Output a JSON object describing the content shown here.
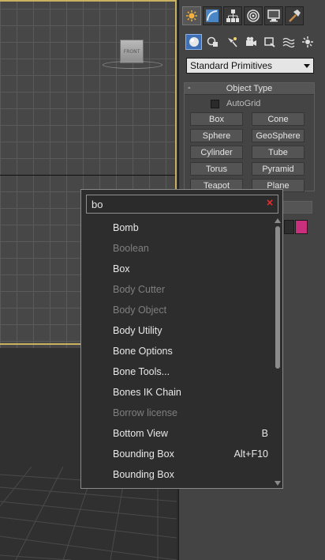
{
  "viewport": {
    "viewcube_label": "FRONT"
  },
  "command_panel": {
    "tabs": [
      {
        "icon": "create-icon",
        "active": true
      },
      {
        "icon": "modify-icon",
        "active": false
      },
      {
        "icon": "hierarchy-icon",
        "active": false
      },
      {
        "icon": "motion-icon",
        "active": false
      },
      {
        "icon": "display-icon",
        "active": false
      },
      {
        "icon": "utilities-icon",
        "active": false
      }
    ],
    "subtabs": [
      {
        "icon": "geometry-icon",
        "active": true
      },
      {
        "icon": "shapes-icon",
        "active": false
      },
      {
        "icon": "lights-icon",
        "active": false
      },
      {
        "icon": "cameras-icon",
        "active": false
      },
      {
        "icon": "helpers-icon",
        "active": false
      },
      {
        "icon": "spacewarps-icon",
        "active": false
      },
      {
        "icon": "systems-icon",
        "active": false
      }
    ],
    "category_value": "Standard Primitives",
    "object_type": {
      "collapse_symbol": "-",
      "title": "Object Type",
      "autogrid_label": "AutoGrid",
      "buttons": [
        "Box",
        "Cone",
        "Sphere",
        "GeoSphere",
        "Cylinder",
        "Tube",
        "Torus",
        "Pyramid",
        "Teapot",
        "Plane"
      ]
    },
    "object_color": "#c8307e"
  },
  "search_popup": {
    "query": "bo",
    "clear_symbol": "×",
    "results": [
      {
        "label": "Bomb",
        "enabled": true,
        "shortcut": ""
      },
      {
        "label": "Boolean",
        "enabled": false,
        "shortcut": ""
      },
      {
        "label": "Box",
        "enabled": true,
        "shortcut": ""
      },
      {
        "label": "Body Cutter",
        "enabled": false,
        "shortcut": ""
      },
      {
        "label": "Body Object",
        "enabled": false,
        "shortcut": ""
      },
      {
        "label": "Body Utility",
        "enabled": true,
        "shortcut": ""
      },
      {
        "label": "Bone Options",
        "enabled": true,
        "shortcut": ""
      },
      {
        "label": "Bone Tools...",
        "enabled": true,
        "shortcut": ""
      },
      {
        "label": "Bones IK Chain",
        "enabled": true,
        "shortcut": ""
      },
      {
        "label": "Borrow license",
        "enabled": false,
        "shortcut": ""
      },
      {
        "label": "Bottom View",
        "enabled": true,
        "shortcut": "B"
      },
      {
        "label": "Bounding Box",
        "enabled": true,
        "shortcut": "Alt+F10"
      },
      {
        "label": "Bounding Box",
        "enabled": true,
        "shortcut": ""
      }
    ]
  }
}
